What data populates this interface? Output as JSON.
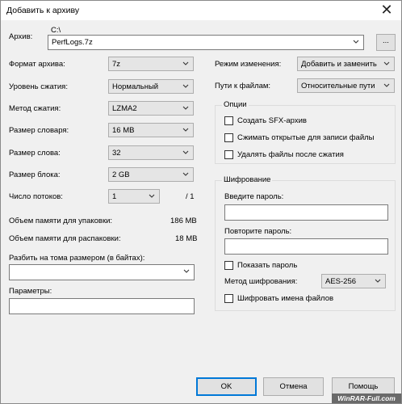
{
  "window": {
    "title": "Добавить к архиву",
    "close_glyph": "✕"
  },
  "archive": {
    "label": "Архив:",
    "path": "C:\\",
    "name": "PerfLogs.7z",
    "browse_label": "..."
  },
  "left": {
    "format": {
      "label": "Формат архива:",
      "value": "7z"
    },
    "level": {
      "label": "Уровень сжатия:",
      "value": "Нормальный"
    },
    "method": {
      "label": "Метод сжатия:",
      "value": "LZMA2"
    },
    "dict": {
      "label": "Размер словаря:",
      "value": "16 MB"
    },
    "word": {
      "label": "Размер слова:",
      "value": "32"
    },
    "block": {
      "label": "Размер блока:",
      "value": "2 GB"
    },
    "threads": {
      "label": "Число потоков:",
      "value": "1",
      "max": "/ 1"
    },
    "mem_pack": {
      "label": "Объем памяти для упаковки:",
      "value": "186 MB"
    },
    "mem_unpack": {
      "label": "Объем памяти для распаковки:",
      "value": "18 MB"
    },
    "split": {
      "label": "Разбить на тома размером (в байтах):",
      "value": ""
    },
    "params": {
      "label": "Параметры:",
      "value": ""
    }
  },
  "right": {
    "update_mode": {
      "label": "Режим изменения:",
      "value": "Добавить и заменить"
    },
    "path_mode": {
      "label": "Пути к файлам:",
      "value": "Относительные пути"
    },
    "options": {
      "title": "Опции",
      "items": [
        {
          "label": "Создать SFX-архив",
          "checked": false
        },
        {
          "label": "Сжимать открытые для записи файлы",
          "checked": false
        },
        {
          "label": "Удалять файлы после сжатия",
          "checked": false
        }
      ]
    },
    "encryption": {
      "title": "Шифрование",
      "password_label": "Введите пароль:",
      "repeat_label": "Повторите пароль:",
      "show_password": "Показать пароль",
      "method_label": "Метод шифрования:",
      "method_value": "AES-256",
      "encrypt_names": "Шифровать имена файлов"
    }
  },
  "buttons": {
    "ok": "OK",
    "cancel": "Отмена",
    "help": "Помощь"
  },
  "watermark": "WinRAR-Full.com"
}
